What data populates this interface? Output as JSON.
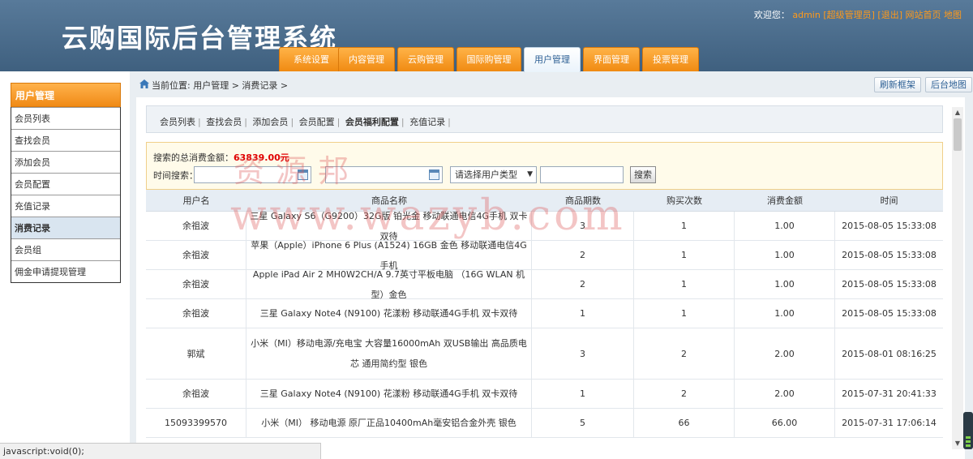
{
  "header": {
    "logo": "云购国际后台管理系统",
    "welcome_prefix": "欢迎您：",
    "admin": "admin",
    "role": "[超级管理员]",
    "logout": "[退出]",
    "site_home": "网站首页",
    "map": "地图"
  },
  "nav": {
    "tabs": [
      {
        "label": "系统设置",
        "active": false
      },
      {
        "label": "内容管理",
        "active": false
      },
      {
        "label": "云购管理",
        "active": false
      },
      {
        "label": "国际购管理",
        "active": false
      },
      {
        "label": "用户管理",
        "active": true
      },
      {
        "label": "界面管理",
        "active": false
      },
      {
        "label": "投票管理",
        "active": false
      }
    ]
  },
  "sidebar": {
    "title": "用户管理",
    "items": [
      {
        "label": "会员列表",
        "active": false
      },
      {
        "label": "查找会员",
        "active": false
      },
      {
        "label": "添加会员",
        "active": false
      },
      {
        "label": "会员配置",
        "active": false
      },
      {
        "label": "充值记录",
        "active": false
      },
      {
        "label": "消费记录",
        "active": true
      },
      {
        "label": "会员组",
        "active": false
      },
      {
        "label": "佣金申请提现管理",
        "active": false
      }
    ]
  },
  "breadcrumb": "当前位置: 用户管理 > 消费记录 >",
  "top_buttons": {
    "refresh": "刷新框架",
    "backend_map": "后台地图"
  },
  "subnav": {
    "items": [
      {
        "label": "会员列表",
        "bold": false
      },
      {
        "label": "查找会员",
        "bold": false
      },
      {
        "label": "添加会员",
        "bold": false
      },
      {
        "label": "会员配置",
        "bold": false
      },
      {
        "label": "会员福利配置",
        "bold": true
      },
      {
        "label": "充值记录",
        "bold": false
      }
    ]
  },
  "search": {
    "total_label": "搜索的总消费金额：",
    "total_value": "63839.00元",
    "time_label": "时间搜索：",
    "dash": "-",
    "user_type_select": "请选择用户类型",
    "search_button": "搜索"
  },
  "table": {
    "headers": [
      "用户名",
      "商品名称",
      "商品期数",
      "购买次数",
      "消费金额",
      "时间"
    ],
    "rows": [
      {
        "user": "余祖波",
        "product": "三星 Galaxy S6（G9200）32G版 铂光金 移动联通电信4G手机 双卡双待",
        "period": "3",
        "times": "1",
        "amount": "1.00",
        "time": "2015-08-05 15:33:08"
      },
      {
        "user": "余祖波",
        "product": "苹果（Apple）iPhone 6 Plus (A1524) 16GB 金色 移动联通电信4G手机",
        "period": "2",
        "times": "1",
        "amount": "1.00",
        "time": "2015-08-05 15:33:08"
      },
      {
        "user": "余祖波",
        "product": "Apple iPad Air 2 MH0W2CH/A 9.7英寸平板电脑 （16G WLAN 机型）金色",
        "period": "2",
        "times": "1",
        "amount": "1.00",
        "time": "2015-08-05 15:33:08"
      },
      {
        "user": "余祖波",
        "product": "三星 Galaxy Note4 (N9100) 花漾粉 移动联通4G手机 双卡双待",
        "period": "1",
        "times": "1",
        "amount": "1.00",
        "time": "2015-08-05 15:33:08"
      },
      {
        "user": "郭斌",
        "product": "小米（MI）移动电源/充电宝 大容量16000mAh 双USB输出 高品质电芯 通用简约型 银色",
        "period": "3",
        "times": "2",
        "amount": "2.00",
        "time": "2015-08-01 08:16:25"
      },
      {
        "user": "余祖波",
        "product": "三星 Galaxy Note4 (N9100) 花漾粉 移动联通4G手机 双卡双待",
        "period": "1",
        "times": "2",
        "amount": "2.00",
        "time": "2015-07-31 20:41:33"
      },
      {
        "user": "15093399570",
        "product": "小米（MI） 移动电源 原厂正品10400mAh毫安铝合金外壳 银色",
        "period": "5",
        "times": "66",
        "amount": "66.00",
        "time": "2015-07-31 17:06:14"
      }
    ]
  },
  "watermark": {
    "cn": "资源邦",
    "url": "www.wazyb.com"
  },
  "statusbar": "javascript:void(0);",
  "colors": {
    "header": "#4a6a8c",
    "accent_orange": "#f08a12",
    "total_red": "#e00000"
  }
}
